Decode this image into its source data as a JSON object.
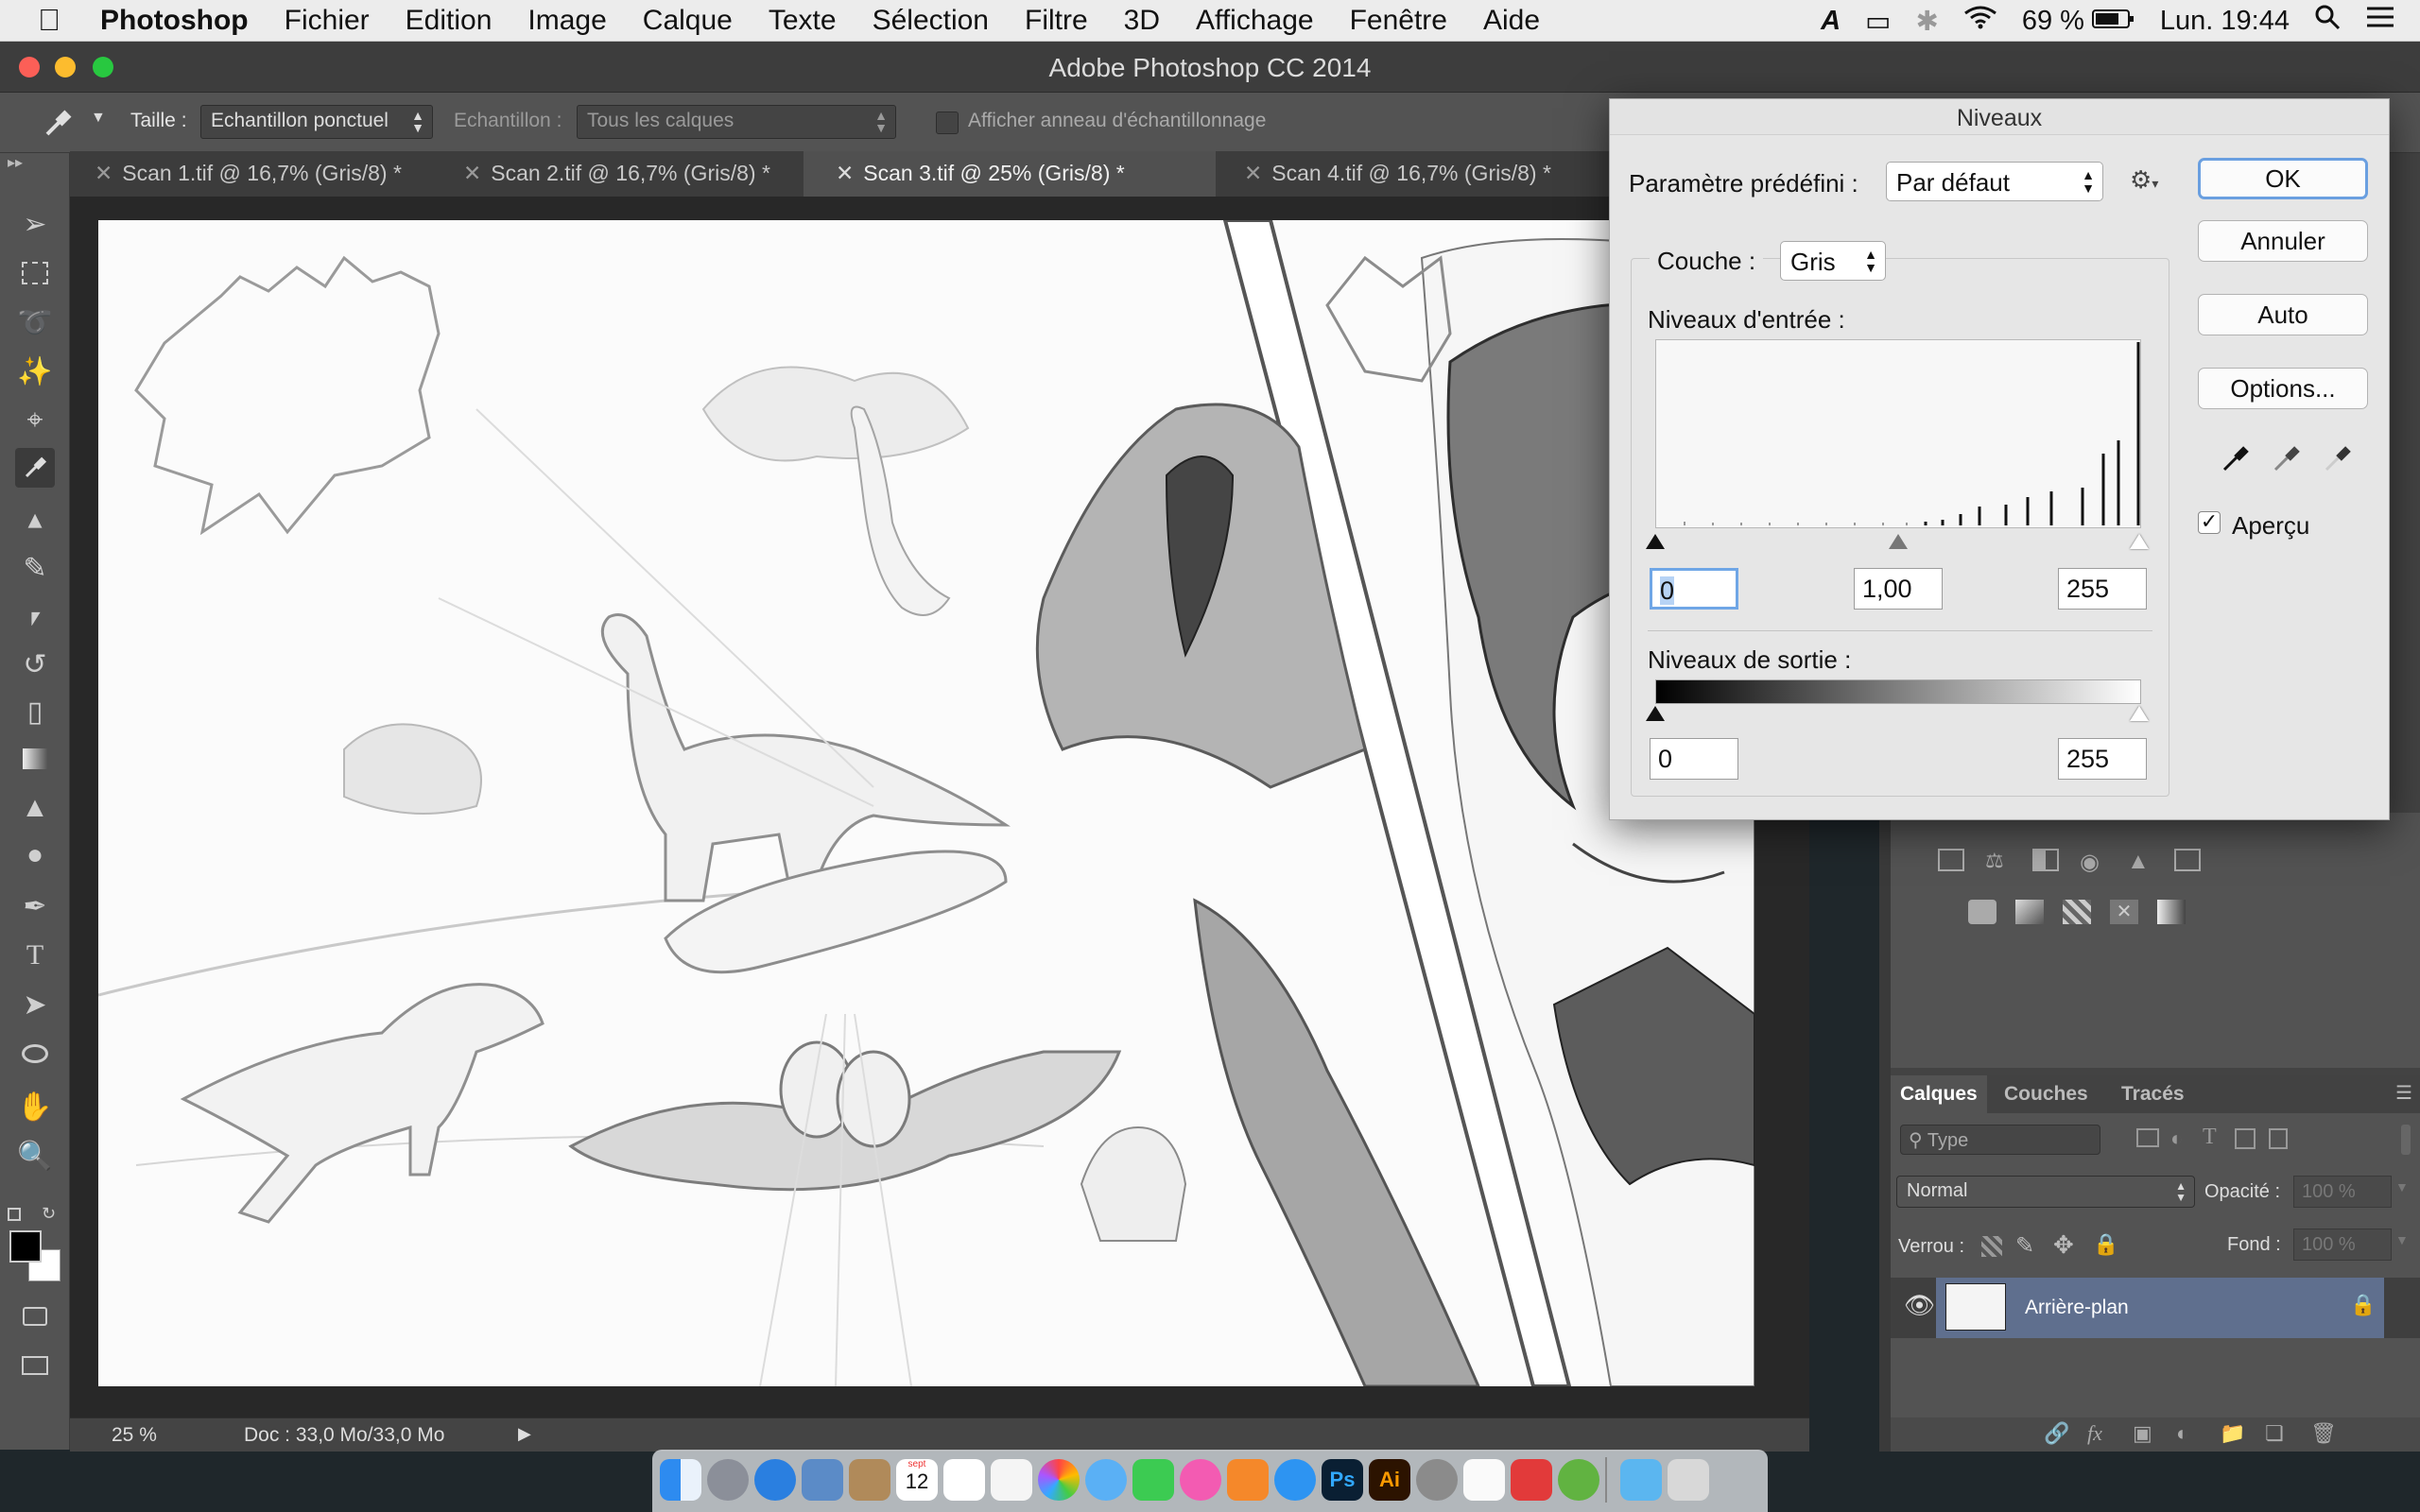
{
  "menubar": {
    "apple_icon": "apple-icon",
    "app": "Photoshop",
    "items": [
      "Fichier",
      "Edition",
      "Image",
      "Calque",
      "Texte",
      "Sélection",
      "Filtre",
      "3D",
      "Affichage",
      "Fenêtre",
      "Aide"
    ],
    "battery": "69 %",
    "clock": "Lun. 19:44"
  },
  "window": {
    "title": "Adobe Photoshop CC 2014"
  },
  "options": {
    "size_label": "Taille :",
    "size_value": "Echantillon ponctuel",
    "sample_label": "Echantillon :",
    "sample_value": "Tous les calques",
    "ring_label": "Afficher anneau d'échantillonnage"
  },
  "tabs": [
    {
      "label": "Scan 1.tif @ 16,7% (Gris/8) *"
    },
    {
      "label": "Scan 2.tif @ 16,7% (Gris/8) *"
    },
    {
      "label": "Scan 3.tif @ 25% (Gris/8) *"
    },
    {
      "label": "Scan 4.tif @ 16,7% (Gris/8) *"
    }
  ],
  "status": {
    "zoom": "25 %",
    "doc": "Doc : 33,0 Mo/33,0 Mo"
  },
  "levels": {
    "title": "Niveaux",
    "preset_label": "Paramètre prédéfini :",
    "preset_value": "Par défaut",
    "channel_label": "Couche :",
    "channel_value": "Gris",
    "input_label": "Niveaux d'entrée :",
    "input_black": "0",
    "input_gamma": "1,00",
    "input_white": "255",
    "output_label": "Niveaux de sortie :",
    "output_black": "0",
    "output_white": "255",
    "ok": "OK",
    "cancel": "Annuler",
    "auto": "Auto",
    "options": "Options...",
    "preview": "Aperçu",
    "preview_checked": true
  },
  "layers_panel": {
    "tabs": [
      "Calques",
      "Couches",
      "Tracés"
    ],
    "filter": "Type",
    "blend_mode": "Normal",
    "opacity_label": "Opacité :",
    "opacity_value": "100 %",
    "lock_label": "Verrou :",
    "fill_label": "Fond :",
    "fill_value": "100 %",
    "layer_name": "Arrière-plan"
  },
  "dock": {
    "calendar_date": "12",
    "calendar_month": "sept"
  }
}
